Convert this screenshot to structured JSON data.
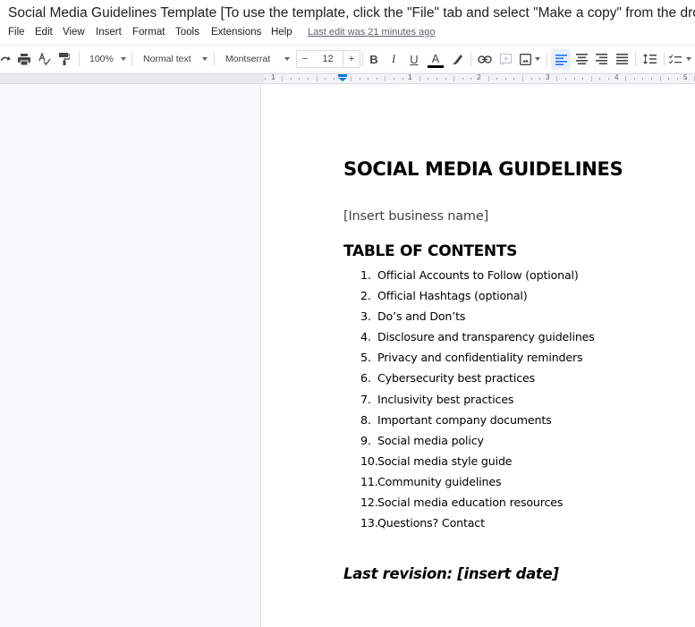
{
  "app": {
    "title": "Social Media Guidelines Template [To use the template, click the \"File\" tab and select \"Make a copy\" from the drop-down"
  },
  "menu": {
    "items": [
      "File",
      "Edit",
      "View",
      "Insert",
      "Format",
      "Tools",
      "Extensions",
      "Help"
    ],
    "last_edit": "Last edit was 21 minutes ago"
  },
  "toolbar": {
    "zoom": "100%",
    "style": "Normal text",
    "font": "Montserrat",
    "font_size": "12",
    "decrease_label": "−",
    "increase_label": "+",
    "bold_label": "B",
    "italic_label": "I",
    "underline_label": "U",
    "text_color_label": "A",
    "text_color": "#000000",
    "active_alignment": "left",
    "accent": "#1a73e8"
  },
  "ruler": {
    "labels": [
      "1",
      "1",
      "2",
      "3",
      "4",
      "5"
    ]
  },
  "document": {
    "title": "SOCIAL MEDIA GUIDELINES",
    "business_placeholder": "[Insert business name]",
    "toc_heading": "TABLE OF CONTENTS",
    "toc": [
      {
        "num": "1.",
        "text": "Official Accounts to Follow (optional)"
      },
      {
        "num": "2.",
        "text": "Official Hashtags (optional)"
      },
      {
        "num": "3.",
        "text": "Do’s and Don’ts"
      },
      {
        "num": "4.",
        "text": "Disclosure and transparency guidelines"
      },
      {
        "num": "5.",
        "text": "Privacy and confidentiality reminders"
      },
      {
        "num": "6.",
        "text": "Cybersecurity best practices"
      },
      {
        "num": "7.",
        "text": "Inclusivity best practices"
      },
      {
        "num": "8.",
        "text": "Important company documents"
      },
      {
        "num": "9.",
        "text": "Social media policy"
      },
      {
        "num": "10.",
        "text": "Social media style guide"
      },
      {
        "num": "11.",
        "text": "Community guidelines"
      },
      {
        "num": "12.",
        "text": "Social media education resources"
      },
      {
        "num": "13.",
        "text": "Questions? Contact"
      }
    ],
    "revision": "Last revision: [insert date]"
  }
}
